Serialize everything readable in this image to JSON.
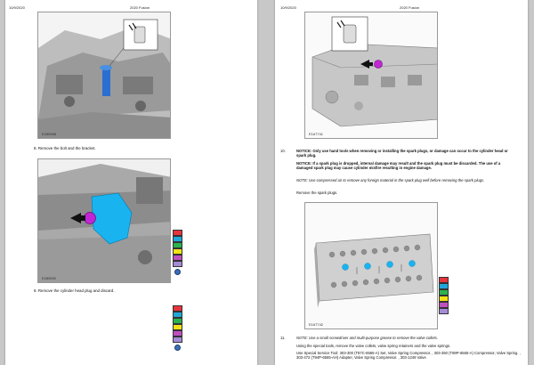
{
  "left": {
    "date": "10/9/2020",
    "doc_title": "2020 Fusion",
    "fig1_id": "E289598",
    "step8": "8.  Remove the bolt and the bracket.",
    "fig2_id": "E289592",
    "step9": "9.  Remove the cylinder head plug and discard."
  },
  "right": {
    "date": "10/9/2020",
    "doc_title": "2020 Fusion",
    "fig1_id": "E167741",
    "step10_label": "10.",
    "note1": "NOTICE: Only use hand tools when removing or installing the spark plugs, or damage can occur to the cylinder head or spark plug.",
    "note2": "NOTICE: If a spark plug is dropped, internal damage may result and the spark plug must be discarded. The use of a damaged spark plug may cause cylinder misfire resulting in engine damage.",
    "note3": "NOTE: Use compressed air to remove any foreign material in the spark plug well before removing the spark plugs.",
    "step10_text": "Remove the spark plugs.",
    "fig2_id": "E167742",
    "step11_label": "11.",
    "note4": "NOTE: Use a small screwdriver and multi-purpose grease to remove the valve collets.",
    "step11_text": "Using the special tools, remove the valve collets, valve spring retainers and the valve springs.",
    "step11_tools": "Use Special Service Tool: 303-300 (T87C-6565-A)  Set, Valve Spring Compressor. , 303-350 (T89P-6565-A) Compressor, Valve Spring. , 303-472 (T94P-6565-AH)  Adapter, Valve Spring Compressor. , 303-1249  Valve"
  },
  "colors": {
    "swatches": [
      "#e6343c",
      "#1fa7d8",
      "#2bb24c",
      "#f2e216",
      "#c04fc0",
      "#a58bd6"
    ]
  }
}
